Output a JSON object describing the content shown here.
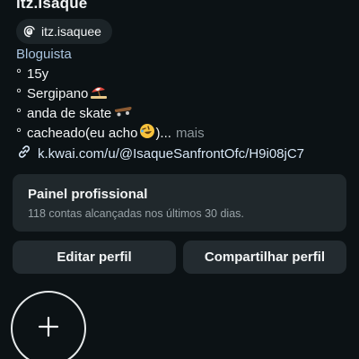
{
  "profile": {
    "username": "itz.Isaque",
    "threads_handle": "itz.isaquee",
    "threads_icon": "threads-icon",
    "category": "Bloguista"
  },
  "bio": {
    "bullet": "°",
    "lines": [
      {
        "text": "15y",
        "emoji": ""
      },
      {
        "text": "Sergipano",
        "emoji": "beach-umbrella-emoji"
      },
      {
        "text": "anda de skate",
        "emoji": "skateboard-emoji"
      },
      {
        "text": "cacheado(eu acho",
        "emoji": "rolling-laughing-emoji",
        "suffix": ")...",
        "more": "mais"
      }
    ],
    "link_icon": "link-icon",
    "link": "k.kwai.com/u/@IsaqueSanfrontOfc/H9i08jC7"
  },
  "professional_panel": {
    "title": "Painel profissional",
    "subtitle": "118 contas alcançadas nos últimos 30 dias."
  },
  "actions": {
    "edit_label": "Editar perfil",
    "share_label": "Compartilhar perfil"
  },
  "highlights": {
    "add_icon": "plus-icon"
  },
  "colors": {
    "background": "#0c1215",
    "category_text": "#a9c3de",
    "card": "#20282c",
    "button": "#232b30"
  }
}
